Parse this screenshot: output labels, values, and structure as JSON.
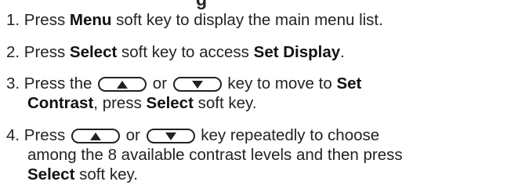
{
  "header_cut": "g",
  "steps": [
    {
      "num": "1.",
      "t1": " Press ",
      "b1": "Menu",
      "t2": " soft key to display the main menu list."
    },
    {
      "num": "2.",
      "t1": " Press ",
      "b1": "Select",
      "t2": " soft key to access ",
      "b2": "Set Display",
      "t3": "."
    },
    {
      "num": "3.",
      "t1": " Press the ",
      "t2": " or ",
      "t3": " key to move to ",
      "b1": "Set",
      "b2": "Contrast",
      "t4": ", press ",
      "b3": "Select",
      "t5": " soft key."
    },
    {
      "num": "4.",
      "t1": " Press ",
      "t2": " or ",
      "t3": " key repeatedly to choose",
      "line2": "among the 8 available contrast levels and then press",
      "b1": "Select",
      "t4": " soft key."
    }
  ],
  "icons": {
    "up_key": "up-arrow-key-icon",
    "down_key": "down-arrow-key-icon"
  }
}
